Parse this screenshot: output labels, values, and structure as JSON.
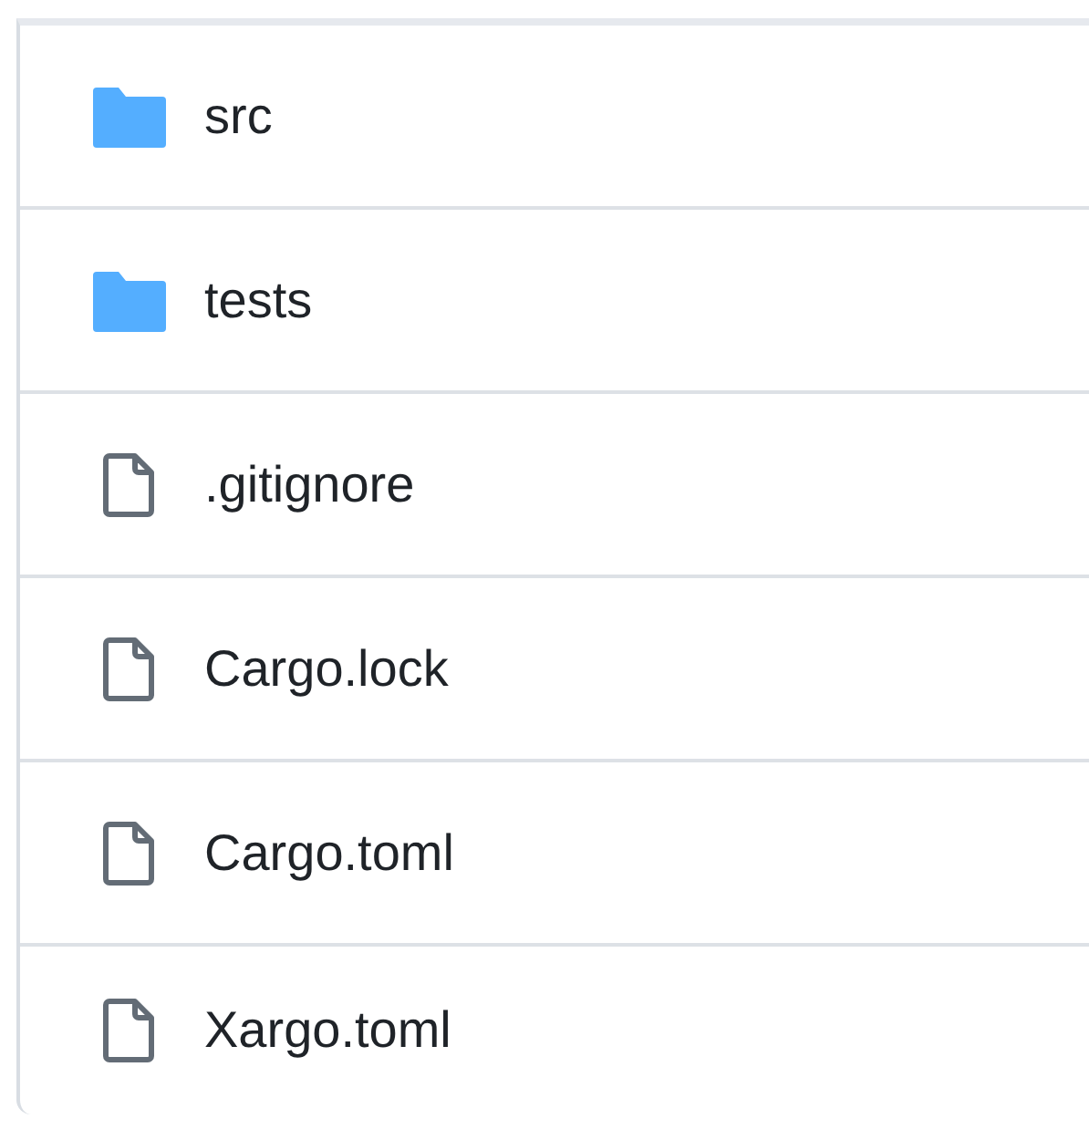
{
  "files": [
    {
      "kind": "folder",
      "name": "src"
    },
    {
      "kind": "folder",
      "name": "tests"
    },
    {
      "kind": "file",
      "name": ".gitignore"
    },
    {
      "kind": "file",
      "name": "Cargo.lock"
    },
    {
      "kind": "file",
      "name": "Cargo.toml"
    },
    {
      "kind": "file",
      "name": "Xargo.toml"
    }
  ]
}
